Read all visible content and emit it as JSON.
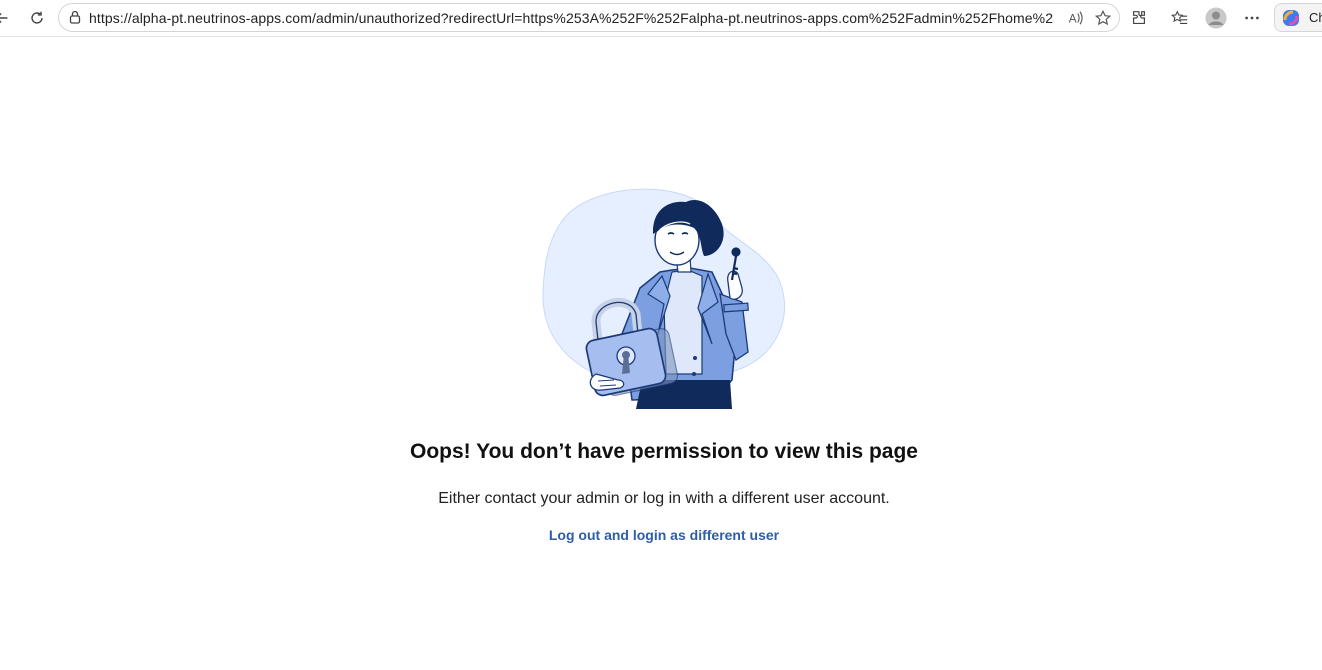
{
  "browser": {
    "url": "https://alpha-pt.neutrinos-apps.com/admin/unauthorized?redirectUrl=https%253A%252F%252Falpha-pt.neutrinos-apps.com%252Fadmin%252Fhome%25...",
    "copilot_label": "Ch",
    "icons": [
      "back-icon",
      "refresh-icon",
      "lock-icon",
      "read-aloud-icon",
      "favorite-star-icon",
      "extensions-icon",
      "favorites-icon",
      "profile-icon",
      "more-icon",
      "copilot-icon"
    ]
  },
  "page": {
    "title": "Oops! You don’t have permission to view this page",
    "subtitle": "Either contact your admin or log in with a different user account.",
    "link_label": "Log out and login as different user"
  },
  "colors": {
    "link": "#2f5ea8",
    "illustration_blue": "#6f93d8",
    "illustration_dark": "#112a5c",
    "blob": "#e6efff"
  }
}
